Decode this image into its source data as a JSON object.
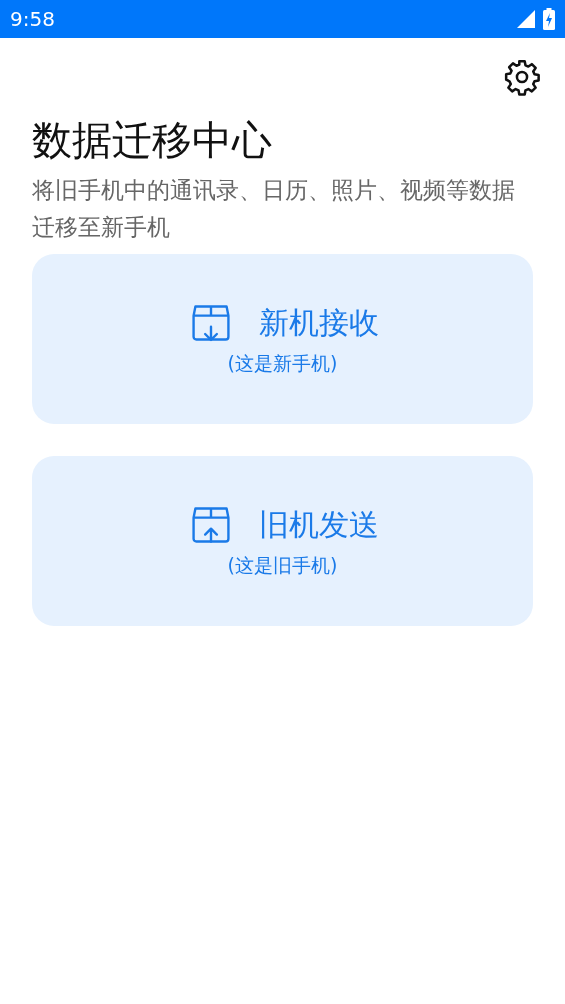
{
  "status_bar": {
    "time": "9:58"
  },
  "title": "数据迁移中心",
  "description": "将旧手机中的通讯录、日历、照片、视频等数据迁移至新手机",
  "options": [
    {
      "kind": "receive",
      "label": "新机接收",
      "hint": "(这是新手机)"
    },
    {
      "kind": "send",
      "label": "旧机发送",
      "hint": "(这是旧手机)"
    }
  ]
}
